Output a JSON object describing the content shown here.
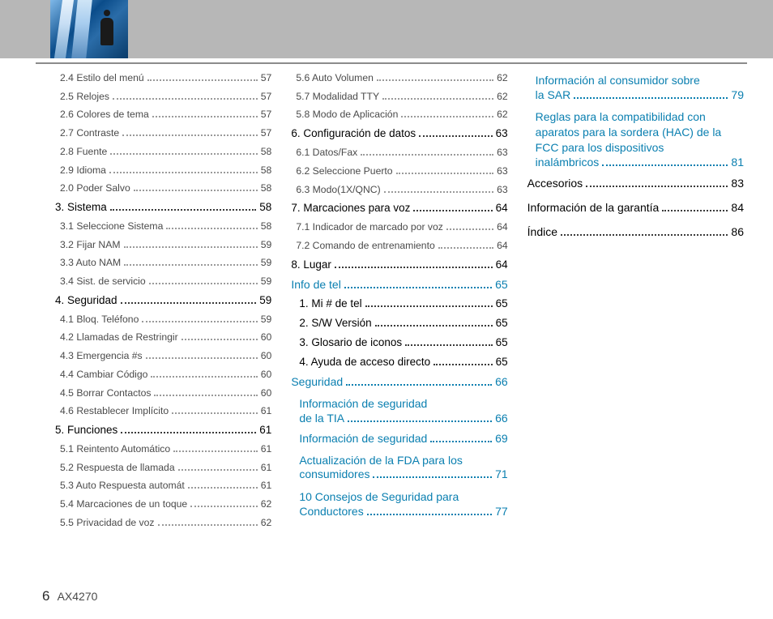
{
  "footer": {
    "page": "6",
    "model": "AX4270"
  },
  "col1": [
    {
      "t": "sub",
      "l": "2.4 Estilo del menú",
      "p": "57"
    },
    {
      "t": "sub",
      "l": "2.5 Relojes",
      "p": "57"
    },
    {
      "t": "sub",
      "l": "2.6 Colores de tema",
      "p": "57"
    },
    {
      "t": "sub",
      "l": "2.7 Contraste",
      "p": "57"
    },
    {
      "t": "sub",
      "l": "2.8 Fuente",
      "p": "58"
    },
    {
      "t": "sub",
      "l": "2.9 Idioma",
      "p": "58"
    },
    {
      "t": "sub",
      "l": "2.0 Poder Salvo",
      "p": "58"
    },
    {
      "t": "section",
      "l": "3. Sistema",
      "p": "58"
    },
    {
      "t": "sub",
      "l": "3.1 Seleccione Sistema",
      "p": "58"
    },
    {
      "t": "sub",
      "l": "3.2 Fijar NAM",
      "p": "59"
    },
    {
      "t": "sub",
      "l": "3.3 Auto NAM",
      "p": "59"
    },
    {
      "t": "sub",
      "l": "3.4 Sist. de servicio",
      "p": "59"
    },
    {
      "t": "section",
      "l": "4. Seguridad",
      "p": "59"
    },
    {
      "t": "sub",
      "l": "4.1 Bloq. Teléfono",
      "p": "59"
    },
    {
      "t": "sub",
      "l": "4.2 Llamadas de Restringir",
      "p": "60"
    },
    {
      "t": "sub",
      "l": "4.3 Emergencia #s",
      "p": "60"
    },
    {
      "t": "sub",
      "l": "4.4 Cambiar Código",
      "p": "60"
    },
    {
      "t": "sub",
      "l": "4.5 Borrar Contactos",
      "p": "60"
    },
    {
      "t": "sub",
      "l": "4.6 Restablecer Implícito",
      "p": "61"
    },
    {
      "t": "section",
      "l": "5. Funciones",
      "p": "61"
    },
    {
      "t": "sub",
      "l": "5.1 Reintento Automático",
      "p": "61"
    },
    {
      "t": "sub",
      "l": "5.2 Respuesta de llamada",
      "p": "61"
    },
    {
      "t": "sub",
      "l": "5.3 Auto Respuesta automát",
      "p": "61"
    },
    {
      "t": "sub",
      "l": "5.4 Marcaciones de un toque",
      "p": "62"
    },
    {
      "t": "sub",
      "l": "5.5 Privacidad de voz",
      "p": "62"
    }
  ],
  "col2": [
    {
      "t": "sub",
      "l": "5.6 Auto Volumen",
      "p": "62"
    },
    {
      "t": "sub",
      "l": "5.7 Modalidad TTY",
      "p": "62"
    },
    {
      "t": "sub",
      "l": "5.8 Modo de Aplicación",
      "p": "62"
    },
    {
      "t": "section",
      "l": "6. Configuración de datos",
      "p": "63"
    },
    {
      "t": "sub",
      "l": "6.1 Datos/Fax",
      "p": "63"
    },
    {
      "t": "sub",
      "l": "6.2 Seleccione Puerto",
      "p": "63"
    },
    {
      "t": "sub",
      "l": "6.3 Modo(1X/QNC)",
      "p": "63"
    },
    {
      "t": "section",
      "l": "7. Marcaciones para voz",
      "p": "64"
    },
    {
      "t": "sub",
      "l": "7.1 Indicador de marcado por voz",
      "p": "64"
    },
    {
      "t": "sub",
      "l": "7.2 Comando de entrenamiento",
      "p": "64"
    },
    {
      "t": "section",
      "l": "8. Lugar",
      "p": "64"
    },
    {
      "t": "head",
      "l": "Info de tel",
      "p": "65"
    },
    {
      "t": "section",
      "l": "1. Mi # de tel",
      "p": "65",
      "ind": true
    },
    {
      "t": "section",
      "l": "2. S/W Versión",
      "p": "65",
      "ind": true
    },
    {
      "t": "section",
      "l": "3. Glosario de iconos",
      "p": "65",
      "ind": true
    },
    {
      "t": "section",
      "l": "4. Ayuda de acceso directo",
      "p": "65",
      "ind": true
    },
    {
      "t": "head",
      "l": "Seguridad",
      "p": "66"
    },
    {
      "t": "head2multi",
      "pre": "Información de seguridad",
      "l": "de la TIA",
      "p": "66"
    },
    {
      "t": "head2",
      "l": "Información de seguridad",
      "p": "69"
    },
    {
      "t": "head2multi",
      "pre": "Actualización de la FDA para los",
      "l": "consumidores",
      "p": "71"
    },
    {
      "t": "head2multi",
      "pre": "10 Consejos de Seguridad para",
      "l": "Conductores",
      "p": "77"
    }
  ],
  "col3": [
    {
      "t": "head2multi",
      "pre": "Información al consumidor sobre",
      "l": "la SAR",
      "p": "79"
    },
    {
      "t": "head2multi",
      "pre": "Reglas para la compatibilidad con aparatos para la sordera (HAC) de la FCC para los dispositivos",
      "l": "inalámbricos",
      "p": "81"
    },
    {
      "t": "headblack",
      "l": "Accesorios",
      "p": "83"
    },
    {
      "t": "headblack",
      "l": "Información de la garantía",
      "p": "84"
    },
    {
      "t": "headblack",
      "l": "Índice",
      "p": "86"
    }
  ]
}
